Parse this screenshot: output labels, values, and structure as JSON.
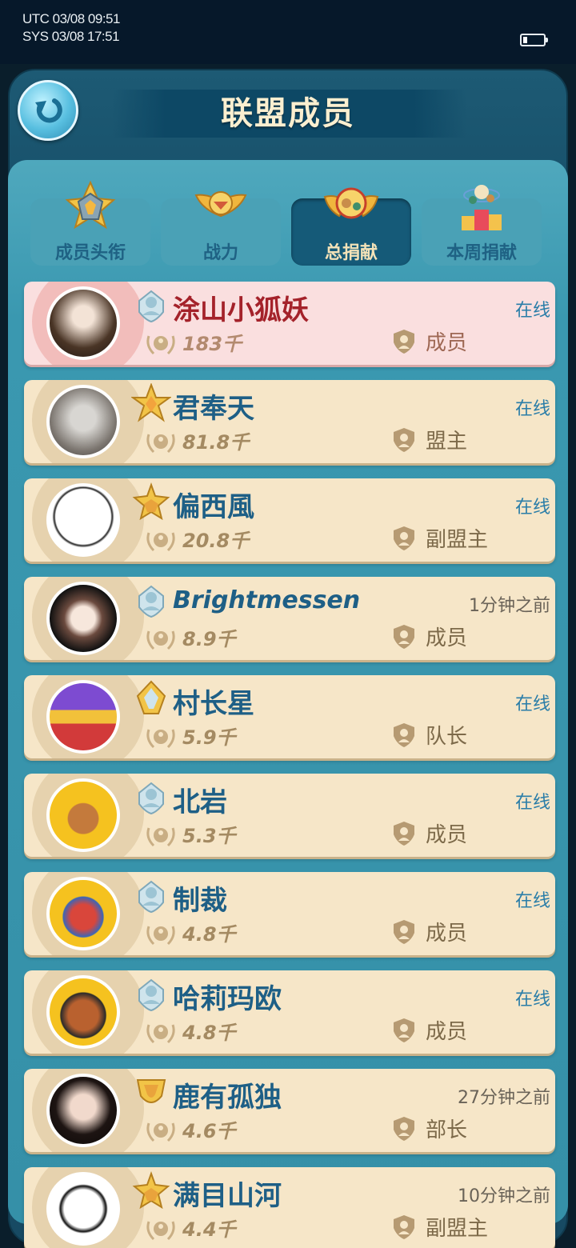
{
  "statusbar": {
    "utc": "UTC 03/08 09:51",
    "sys": "SYS 03/08 17:51",
    "battery_icon": "battery-low-icon"
  },
  "header": {
    "title": "联盟成员",
    "back_icon": "back-arrow-icon"
  },
  "tabs": [
    {
      "label": "成员头衔",
      "icon": "rank-badge-icon",
      "active": false
    },
    {
      "label": "战力",
      "icon": "winged-emblem-icon",
      "active": false
    },
    {
      "label": "总捐献",
      "icon": "winged-orb-icon",
      "active": true
    },
    {
      "label": "本周捐献",
      "icon": "podium-icon",
      "active": false
    }
  ],
  "members": [
    {
      "name": "涂山小狐妖",
      "status": "在线",
      "power": "183千",
      "role": "成员",
      "rank_icon": "member-rank-icon",
      "highlight": true
    },
    {
      "name": "君奉天",
      "status": "在线",
      "power": "81.8千",
      "role": "盟主",
      "rank_icon": "leader-star-icon"
    },
    {
      "name": "偏西風",
      "status": "在线",
      "power": "20.8千",
      "role": "副盟主",
      "rank_icon": "vice-leader-star-icon"
    },
    {
      "name": "Brightmessen",
      "status": "1分钟之前",
      "power": "8.9千",
      "role": "成员",
      "rank_icon": "member-rank-icon"
    },
    {
      "name": "村长星",
      "status": "在线",
      "power": "5.9千",
      "role": "队长",
      "rank_icon": "captain-rank-icon"
    },
    {
      "name": "北岩",
      "status": "在线",
      "power": "5.3千",
      "role": "成员",
      "rank_icon": "member-rank-icon"
    },
    {
      "name": "制裁",
      "status": "在线",
      "power": "4.8千",
      "role": "成员",
      "rank_icon": "member-rank-icon"
    },
    {
      "name": "哈莉玛欧",
      "status": "在线",
      "power": "4.8千",
      "role": "成员",
      "rank_icon": "member-rank-icon"
    },
    {
      "name": "鹿有孤独",
      "status": "27分钟之前",
      "power": "4.6千",
      "role": "部长",
      "rank_icon": "minister-rank-icon"
    },
    {
      "name": "满目山河",
      "status": "10分钟之前",
      "power": "4.4千",
      "role": "副盟主",
      "rank_icon": "vice-leader-star-icon"
    }
  ]
}
